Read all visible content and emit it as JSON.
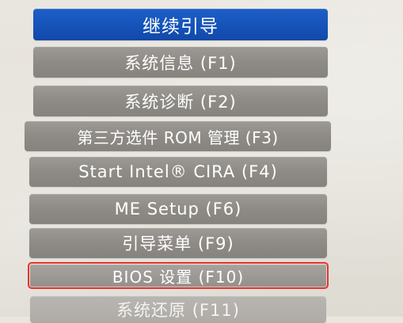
{
  "menu": {
    "items": [
      {
        "label": "继续引导",
        "state": "selected"
      },
      {
        "label": "系统信息 (F1)",
        "state": "normal"
      },
      {
        "label": "系统诊断 (F2)",
        "state": "normal"
      },
      {
        "label": "第三方选件 ROM 管理 (F3)",
        "state": "normal"
      },
      {
        "label": "Start Intel® CIRA (F4)",
        "state": "normal"
      },
      {
        "label": "ME Setup (F6)",
        "state": "normal"
      },
      {
        "label": "引导菜单 (F9)",
        "state": "normal"
      },
      {
        "label": "BIOS 设置 (F10)",
        "state": "highlighted"
      },
      {
        "label": "系统还原 (F11)",
        "state": "normal"
      }
    ]
  },
  "colors": {
    "selected_bg": "#1553b9",
    "item_bg": "#8e8b86",
    "highlight_outline": "#e5342f",
    "screen_bg": "#e6e3dc"
  }
}
